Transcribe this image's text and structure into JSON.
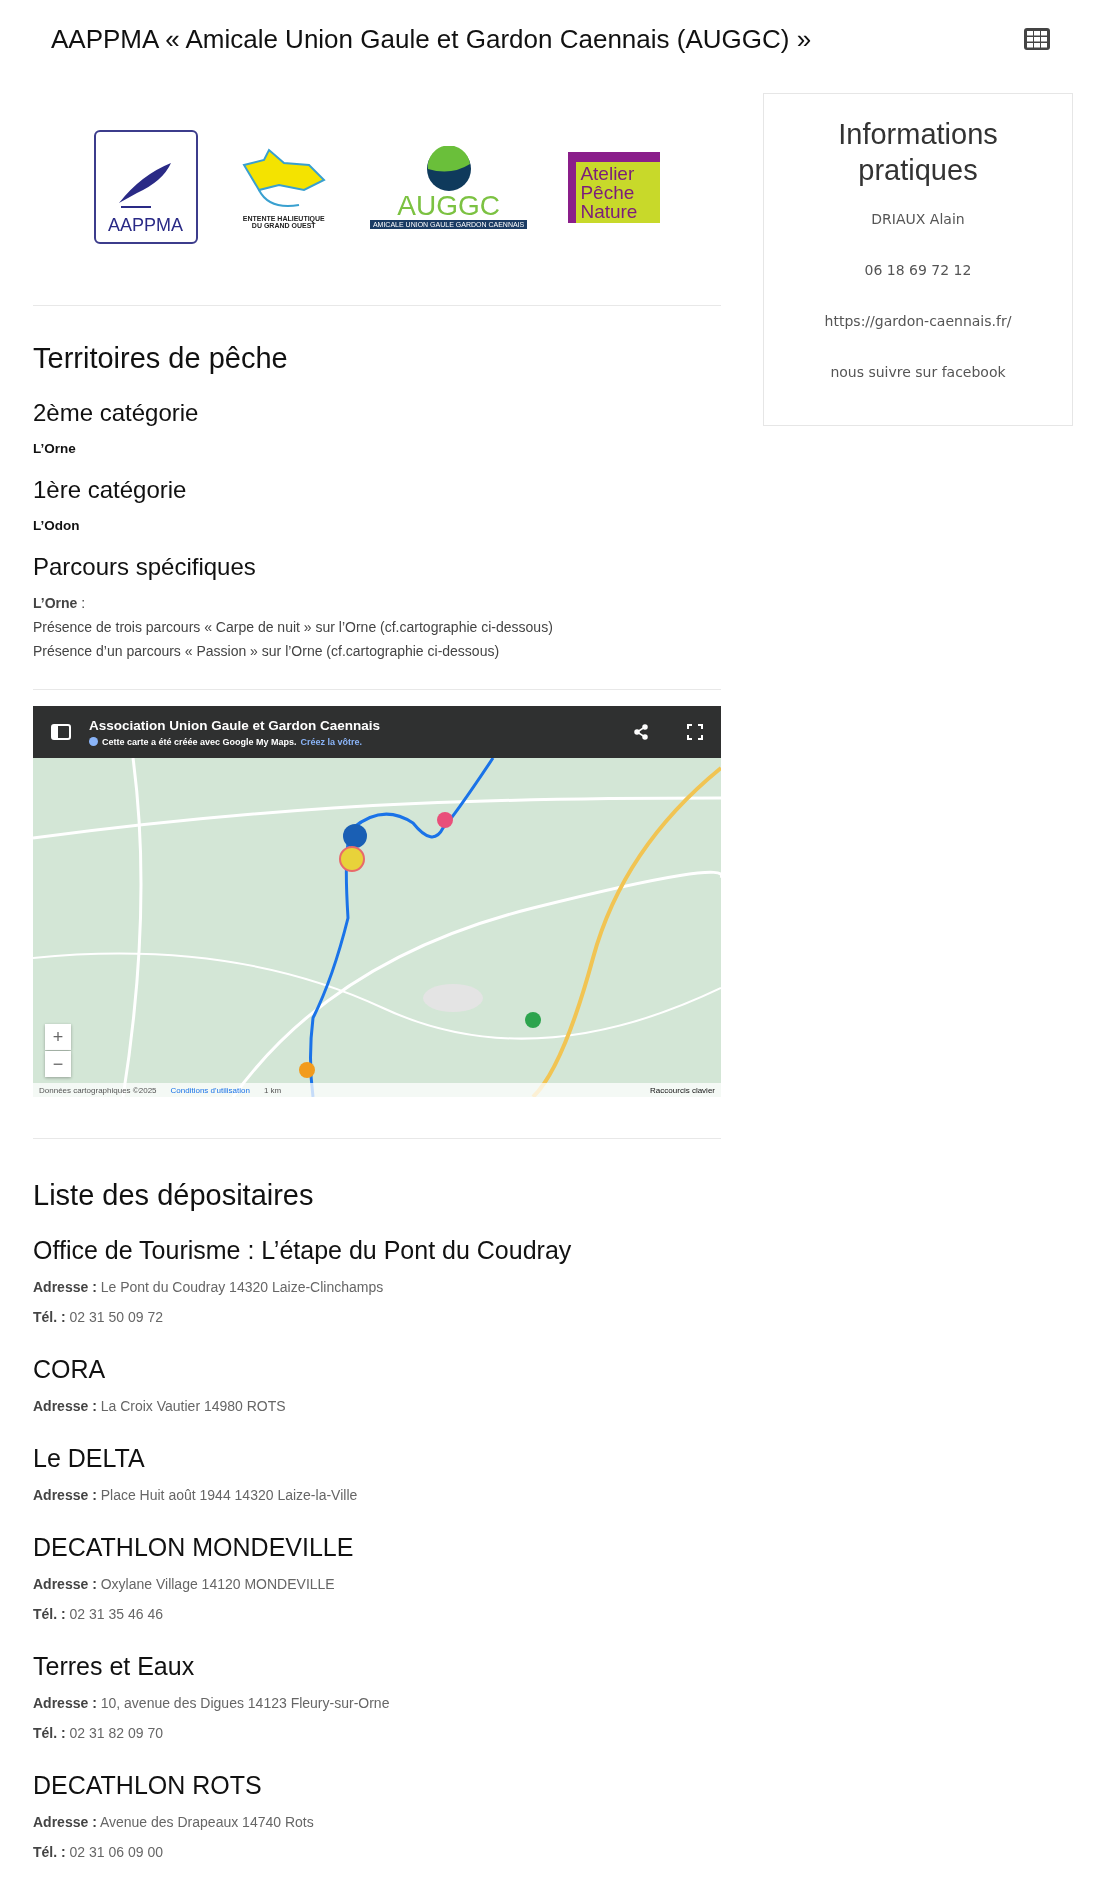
{
  "header": {
    "title": "AAPPMA « Amicale Union Gaule et Gardon Caennais (AUGGC) »"
  },
  "logos": [
    {
      "kind": "aappma",
      "lines": [
        "AAPPMA"
      ]
    },
    {
      "kind": "entente",
      "lines": [
        "ENTENTE HALIEUTIQUE",
        "DU GRAND OUEST"
      ]
    },
    {
      "kind": "auggc",
      "lines": [
        "AUGGC",
        "AMICALE UNION GAULE GARDON CAENNAIS"
      ]
    },
    {
      "kind": "apn",
      "lines": [
        "Atelier",
        "Pêche",
        "Nature"
      ]
    }
  ],
  "territories": {
    "title": "Territoires de pêche",
    "categories": [
      {
        "heading": "2ème catégorie",
        "river": "L’Orne"
      },
      {
        "heading": "1ère catégorie",
        "river": "L’Odon"
      }
    ],
    "parcours": {
      "heading": "Parcours spécifiques",
      "lead": "**L’Orne** :",
      "lines": [
        "Présence de trois parcours « Carpe de nuit » sur l’Orne (cf.cartographie ci-dessous)",
        "Présence d’un parcours « Passion » sur l’Orne (cf.cartographie ci-dessous)"
      ]
    }
  },
  "map": {
    "title": "Association Union Gaule et Gardon Caennais",
    "note": "Cette carte a été créée avec Google My Maps.",
    "link": "Créez la vôtre.",
    "zoom_in": "+",
    "zoom_out": "−",
    "attribution": "Données cartographiques ©2025",
    "terms": "Conditions d'utilisation",
    "scale": "1 km",
    "shortcuts": "Raccourcis clavier"
  },
  "sidebar": {
    "title": "Informations pratiques",
    "lines": [
      "DRIAUX Alain",
      "06 18 69 72 12",
      "https://gardon-caennais.fr/",
      "nous suivre sur facebook"
    ]
  },
  "dealers": {
    "title": "Liste des dépositaires",
    "items": [
      {
        "name": "Office de Tourisme : L’étape du Pont du Coudray",
        "address": "**Adresse :** Le Pont du Coudray 14320 Laize-Clinchamps",
        "phone": "**Tél. :** 02 31 50 09 72"
      },
      {
        "name": "CORA",
        "address": "**Adresse :** La Croix Vautier 14980 ROTS"
      },
      {
        "name": "Le DELTA",
        "address": "**Adresse :** Place Huit août 1944 14320 Laize-la-Ville"
      },
      {
        "name": "DECATHLON MONDEVILLE",
        "address": "**Adresse :** Oxylane Village 14120 MONDEVILLE",
        "phone": "**Tél. :** 02 31 35 46 46"
      },
      {
        "name": "Terres et Eaux",
        "address": "**Adresse :** 10, avenue des Digues 14123 Fleury-sur-Orne",
        "phone": "**Tél. :** 02 31 82 09 70"
      },
      {
        "name": "DECATHLON ROTS",
        "address": "**Adresse :** Avenue des Drapeaux 14740 Rots",
        "phone": "**Tél. :** 02 31 06 09 00"
      }
    ]
  }
}
